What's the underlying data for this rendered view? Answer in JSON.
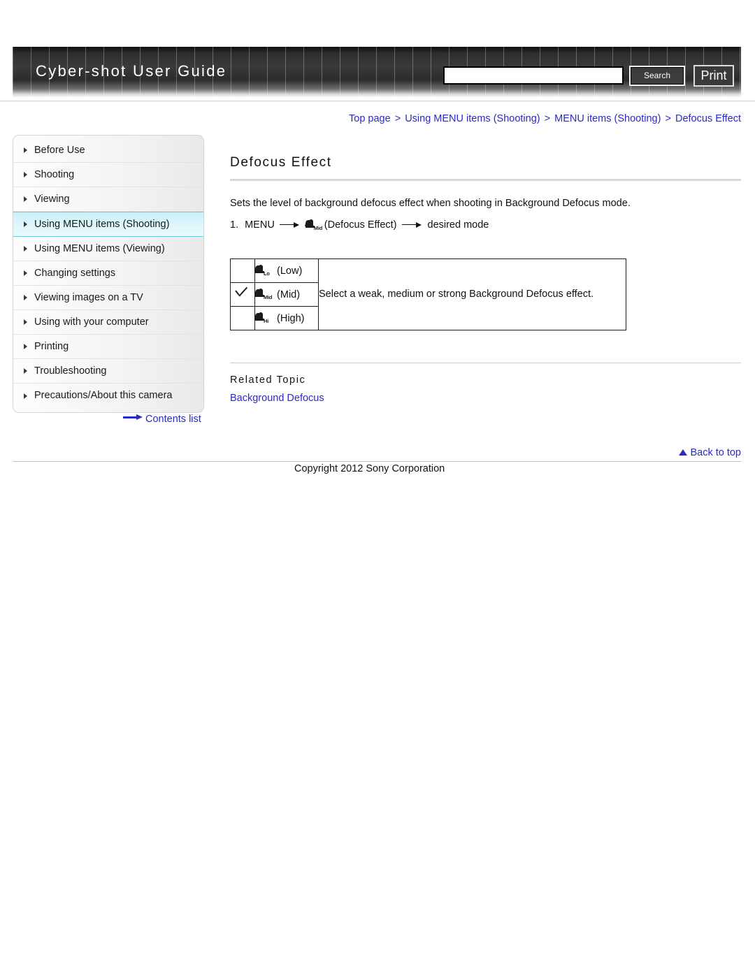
{
  "header": {
    "brand_title": "Cyber-shot User Guide",
    "search_value": "",
    "search_placeholder": "",
    "search_button_label": "Search",
    "print_button_label": "Print"
  },
  "breadcrumb": {
    "separator": ">",
    "items": [
      "Top page",
      "Using MENU items (Shooting)",
      "MENU items (Shooting)",
      "Defocus Effect"
    ]
  },
  "sidebar": {
    "items": [
      {
        "label": "Before Use",
        "active": false
      },
      {
        "label": "Shooting",
        "active": false
      },
      {
        "label": "Viewing",
        "active": false
      },
      {
        "label": "Using MENU items (Shooting)",
        "active": true
      },
      {
        "label": "Using MENU items (Viewing)",
        "active": false
      },
      {
        "label": "Changing settings",
        "active": false
      },
      {
        "label": "Viewing images on a TV",
        "active": false
      },
      {
        "label": "Using with your computer",
        "active": false
      },
      {
        "label": "Printing",
        "active": false
      },
      {
        "label": "Troubleshooting",
        "active": false
      },
      {
        "label": "Precautions/About this camera",
        "active": false
      }
    ],
    "contents_list_label": "Contents list"
  },
  "main": {
    "title": "Defocus Effect",
    "intro": "Sets the level of background defocus effect when shooting in Background Defocus mode.",
    "step": {
      "number": "1.",
      "menu_label": "MENU",
      "icon_sub": "Mid",
      "icon_name": "defocus-effect-icon",
      "icon_caption": "(Defocus Effect)",
      "result": "desired mode"
    },
    "options_table": {
      "rows": [
        {
          "checked": false,
          "icon_sub": "Lo",
          "label": "(Low)",
          "description": ""
        },
        {
          "checked": true,
          "icon_sub": "Mid",
          "label": "(Mid)",
          "description": "Select a weak, medium or strong Background Defocus effect."
        },
        {
          "checked": false,
          "icon_sub": "Hi",
          "label": "(High)",
          "description": ""
        }
      ]
    },
    "related": {
      "heading": "Related Topic",
      "link": "Background Defocus"
    }
  },
  "footer": {
    "back_to_top_label": "Back to top",
    "copyright": "Copyright 2012 Sony Corporation"
  },
  "colors": {
    "link": "#2a2ac0",
    "header_dark": "#303030",
    "active_nav": "#c9f0f8",
    "active_nav_border": "#6fc9dd"
  }
}
